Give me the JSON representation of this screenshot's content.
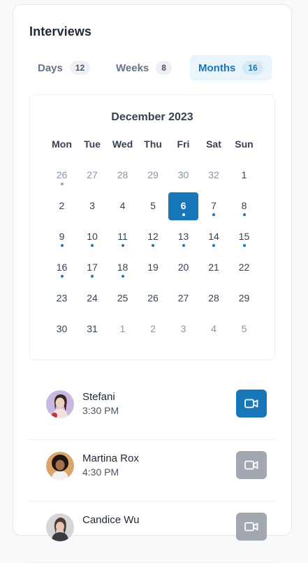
{
  "header": {
    "title": "Interviews"
  },
  "tabs": [
    {
      "label": "Days",
      "count": "12",
      "active": false
    },
    {
      "label": "Weeks",
      "count": "8",
      "active": false
    },
    {
      "label": "Months",
      "count": "16",
      "active": true
    }
  ],
  "calendar": {
    "month_label": "December 2023",
    "weekdays": [
      "Mon",
      "Tue",
      "Wed",
      "Thu",
      "Fri",
      "Sat",
      "Sun"
    ],
    "weeks": [
      [
        {
          "d": "26",
          "other": true,
          "dot": "gray"
        },
        {
          "d": "27",
          "other": true
        },
        {
          "d": "28",
          "other": true
        },
        {
          "d": "29",
          "other": true
        },
        {
          "d": "30",
          "other": true
        },
        {
          "d": "32",
          "other": true
        },
        {
          "d": "1"
        }
      ],
      [
        {
          "d": "2"
        },
        {
          "d": "3"
        },
        {
          "d": "4"
        },
        {
          "d": "5"
        },
        {
          "d": "6",
          "selected": true,
          "dot": "blue"
        },
        {
          "d": "7",
          "dot": "blue"
        },
        {
          "d": "8",
          "dot": "blue"
        }
      ],
      [
        {
          "d": "9",
          "dot": "blue"
        },
        {
          "d": "10",
          "dot": "blue"
        },
        {
          "d": "11",
          "dot": "blue"
        },
        {
          "d": "12",
          "dot": "blue"
        },
        {
          "d": "13",
          "dot": "blue"
        },
        {
          "d": "14",
          "dot": "blue"
        },
        {
          "d": "15",
          "dot": "blue"
        }
      ],
      [
        {
          "d": "16",
          "dot": "blue"
        },
        {
          "d": "17",
          "dot": "blue"
        },
        {
          "d": "18",
          "dot": "blue"
        },
        {
          "d": "19"
        },
        {
          "d": "20"
        },
        {
          "d": "21"
        },
        {
          "d": "22"
        }
      ],
      [
        {
          "d": "23"
        },
        {
          "d": "24"
        },
        {
          "d": "25"
        },
        {
          "d": "26"
        },
        {
          "d": "27"
        },
        {
          "d": "28"
        },
        {
          "d": "29"
        }
      ],
      [
        {
          "d": "30"
        },
        {
          "d": "31"
        },
        {
          "d": "1",
          "other": true
        },
        {
          "d": "2",
          "other": true
        },
        {
          "d": "3",
          "other": true
        },
        {
          "d": "4",
          "other": true
        },
        {
          "d": "5",
          "other": true
        }
      ]
    ]
  },
  "interviews": [
    {
      "name": "Stefani",
      "time": "3:30 PM",
      "video_active": true,
      "icon": "video-camera-icon"
    },
    {
      "name": "Martina Rox",
      "time": "4:30 PM",
      "video_active": false,
      "icon": "video-camera-icon"
    },
    {
      "name": "Candice Wu",
      "time": "",
      "video_active": false,
      "icon": "video-camera-icon"
    }
  ],
  "colors": {
    "accent": "#1877b8",
    "accent_bg": "#eaf4fb",
    "inactive_button": "#a2a8b2"
  }
}
